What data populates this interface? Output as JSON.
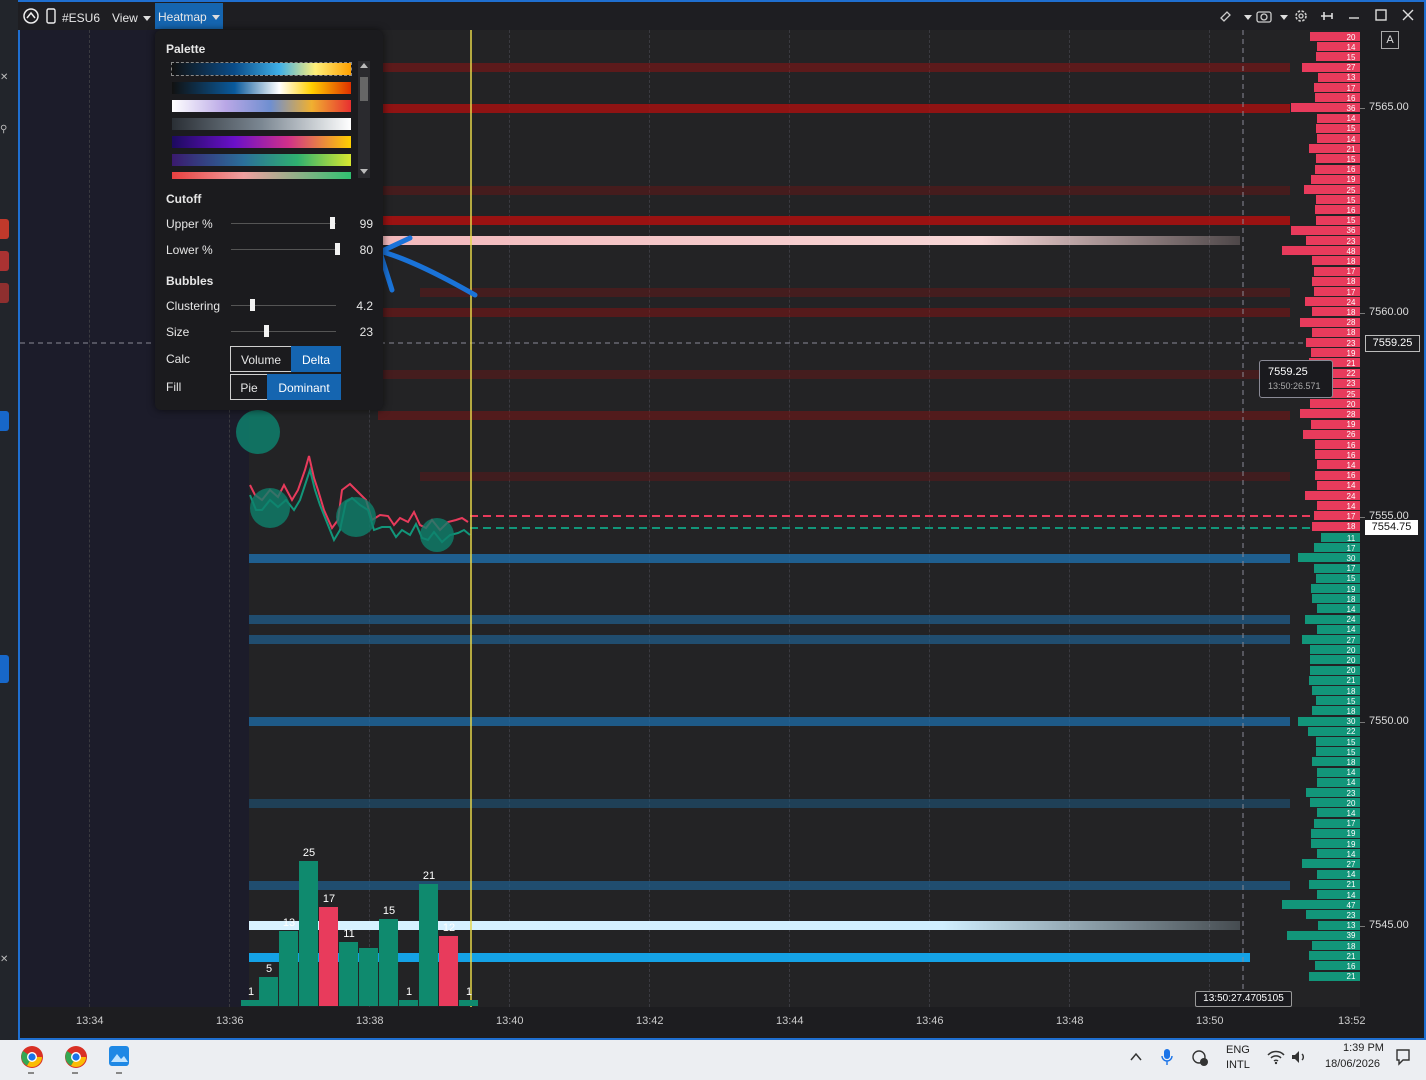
{
  "titlebar": {
    "symbol": "#ESU6",
    "view_menu": "View",
    "heatmap_menu": "Heatmap"
  },
  "panel": {
    "palette_heading": "Palette",
    "cutoff_heading": "Cutoff",
    "upper_label": "Upper %",
    "upper_value": "99",
    "lower_label": "Lower %",
    "lower_value": "80",
    "bubbles_heading": "Bubbles",
    "clustering_label": "Clustering",
    "clustering_value": "4.2",
    "size_label": "Size",
    "size_value": "23",
    "calc_label": "Calc",
    "calc_options": [
      "Volume",
      "Delta"
    ],
    "calc_selected": "Delta",
    "fill_label": "Fill",
    "fill_options": [
      "Pie",
      "Dominant"
    ],
    "fill_selected": "Dominant"
  },
  "price_axis": {
    "ticks": [
      "7565.00",
      "7560.00",
      "7555.00",
      "7550.00",
      "7545.00"
    ],
    "crosshair_price": "7559.25",
    "last_price": "7554.75",
    "corner_button": "A"
  },
  "time_axis": {
    "ticks": [
      "13:34",
      "13:36",
      "13:38",
      "13:40",
      "13:42",
      "13:44",
      "13:46",
      "13:48",
      "13:50",
      "13:52"
    ],
    "cursor_time": "13:50:27.4705105"
  },
  "tooltip": {
    "price": "7559.25",
    "time": "13:50:26.571"
  },
  "ask_volumes": [
    "20",
    "14",
    "15",
    "27",
    "13",
    "17",
    "16",
    "36",
    "14",
    "15",
    "14",
    "21",
    "15",
    "16",
    "19",
    "25",
    "15",
    "16",
    "15",
    "36",
    "23",
    "48",
    "18",
    "17",
    "18",
    "17",
    "24",
    "18",
    "28",
    "18",
    "23",
    "19",
    "21",
    "22",
    "23",
    "25",
    "20",
    "28",
    "19",
    "26",
    "16",
    "16",
    "14",
    "16",
    "14",
    "24",
    "14",
    "17",
    "18"
  ],
  "bid_volumes": [
    "11",
    "17",
    "30",
    "17",
    "15",
    "19",
    "18",
    "14",
    "24",
    "14",
    "27",
    "20",
    "20",
    "20",
    "21",
    "18",
    "15",
    "18",
    "30",
    "22",
    "15",
    "15",
    "18",
    "14",
    "14",
    "23",
    "20",
    "14",
    "17",
    "19",
    "19",
    "14",
    "27",
    "14",
    "21",
    "14",
    "47",
    "23",
    "13",
    "39",
    "18",
    "21",
    "16",
    "21"
  ],
  "volume_bars": [
    {
      "label": "1",
      "value": 1,
      "side": "buy"
    },
    {
      "label": "5",
      "value": 5,
      "side": "buy"
    },
    {
      "label": "13",
      "value": 13,
      "side": "buy"
    },
    {
      "label": "25",
      "value": 25,
      "side": "buy"
    },
    {
      "label": "17",
      "value": 17,
      "side": "sell"
    },
    {
      "label": "11",
      "value": 11,
      "side": "buy"
    },
    {
      "label": "",
      "value": 10,
      "side": "buy"
    },
    {
      "label": "15",
      "value": 15,
      "side": "buy"
    },
    {
      "label": "1",
      "value": 1,
      "side": "buy"
    },
    {
      "label": "21",
      "value": 21,
      "side": "buy"
    },
    {
      "label": "12",
      "value": 12,
      "side": "sell"
    },
    {
      "label": "1",
      "value": 1,
      "side": "buy"
    }
  ],
  "taskbar": {
    "lang_top": "ENG",
    "lang_bottom": "INTL",
    "time": "1:39 PM",
    "date": "18/06/2026"
  },
  "colors": {
    "accent": "#1565b0",
    "ask": "#e83b5c",
    "bid": "#12967a",
    "cursor_line": "#e5d64a",
    "annotation_arrow": "#1a73d8"
  }
}
